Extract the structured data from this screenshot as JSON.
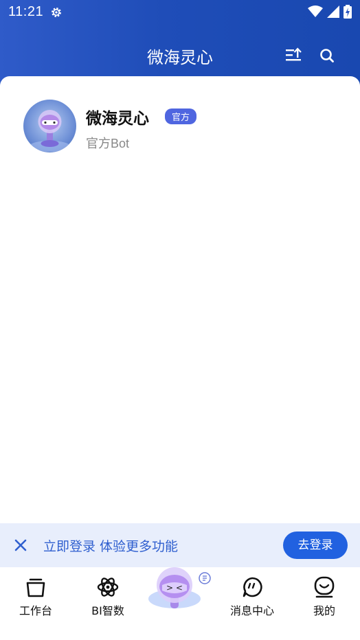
{
  "status_bar": {
    "time": "11:21"
  },
  "header": {
    "title": "微海灵心"
  },
  "bot": {
    "name": "微海灵心",
    "badge": "官方",
    "subtitle": "官方Bot"
  },
  "login_prompt": {
    "text": "立即登录 体验更多功能",
    "button_label": "去登录"
  },
  "tabs": [
    {
      "label": "工作台",
      "icon": "workbench-icon"
    },
    {
      "label": "BI智数",
      "icon": "bi-atom-icon"
    },
    {
      "label": "",
      "icon": "assistant-bot-icon"
    },
    {
      "label": "消息中心",
      "icon": "message-icon"
    },
    {
      "label": "我的",
      "icon": "profile-icon"
    }
  ],
  "colors": {
    "header_blue": "#1f4db8",
    "accent": "#2161e0",
    "badge": "#4f66e0",
    "login_bar_bg": "#e8eefc"
  }
}
